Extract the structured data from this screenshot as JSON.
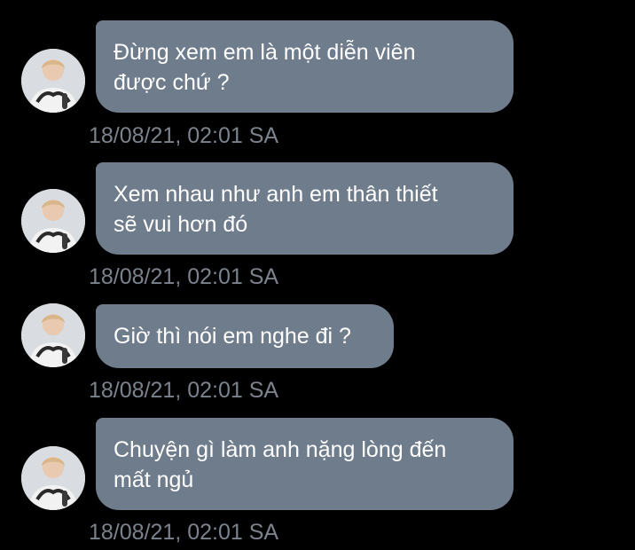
{
  "colors": {
    "background": "#000000",
    "bubble": "#6f7c8c",
    "bubble_text": "#ffffff",
    "timestamp_text": "#7a828d"
  },
  "messages": [
    {
      "text": "Đừng xem em là một diễn viên\nđược chứ ?",
      "timestamp": "18/08/21, 02:01 SA",
      "avatar_icon": "profile-photo"
    },
    {
      "text": "Xem nhau như anh em thân thiết\nsẽ vui hơn đó",
      "timestamp": "18/08/21, 02:01 SA",
      "avatar_icon": "profile-photo"
    },
    {
      "text": "Giờ thì nói em nghe đi ?",
      "timestamp": "18/08/21, 02:01 SA",
      "avatar_icon": "profile-photo"
    },
    {
      "text": "Chuyện gì làm anh nặng lòng đến\nmất ngủ",
      "timestamp": "18/08/21, 02:01 SA",
      "avatar_icon": "profile-photo"
    }
  ]
}
